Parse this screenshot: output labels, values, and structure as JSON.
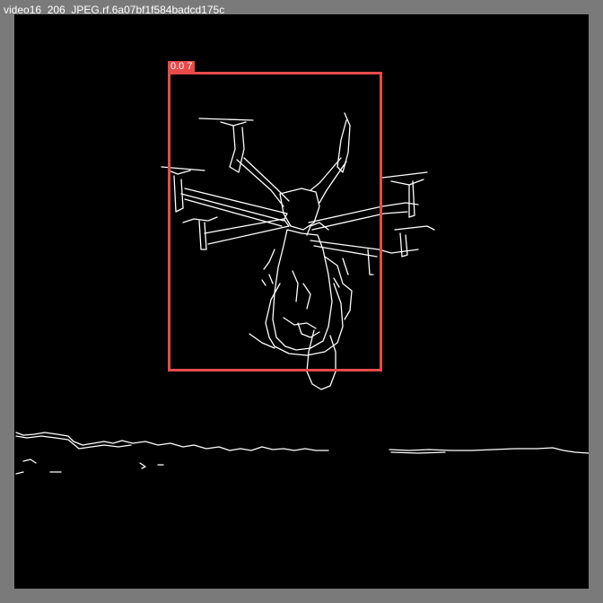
{
  "window": {
    "title": "video16_206_JPEG.rf.6a07bf1f584badcd175c"
  },
  "detection": {
    "label": "0.0 7",
    "color": "#e84a4a"
  },
  "colors": {
    "background": "#7a7a7a",
    "image": "#000000",
    "edges": "#ffffff"
  }
}
